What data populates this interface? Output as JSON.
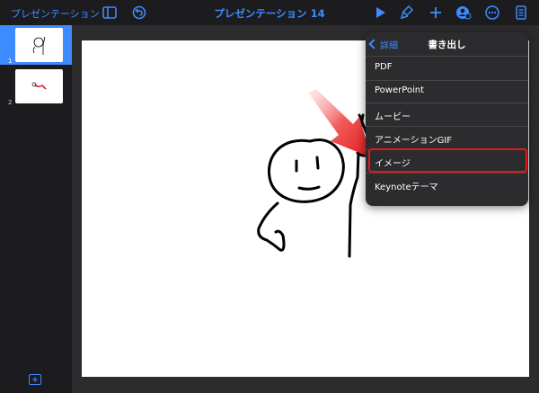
{
  "toolbar": {
    "back_label": "プレゼンテーション",
    "title": "プレゼンテーション 14",
    "icons": [
      "sidebar-icon",
      "undo-icon",
      "play-icon",
      "paintbrush-icon",
      "plus-icon",
      "collaborate-icon",
      "more-icon",
      "document-icon"
    ]
  },
  "navigator": {
    "slides": [
      {
        "number": "1",
        "selected": true
      },
      {
        "number": "2",
        "selected": false
      }
    ]
  },
  "popover": {
    "back_label": "詳細",
    "title": "書き出し",
    "items": [
      {
        "label": "PDF"
      },
      {
        "label": "PowerPoint"
      },
      {
        "label": "ムービー"
      },
      {
        "label": "アニメーションGIF"
      },
      {
        "label": "イメージ"
      },
      {
        "label": "Keynoteテーマ"
      }
    ],
    "highlighted_item": "イメージ"
  },
  "colors": {
    "accent": "#3d8bff",
    "background": "#1c1c1e",
    "popover": "#2c2c2e",
    "highlight": "#e0191b"
  }
}
